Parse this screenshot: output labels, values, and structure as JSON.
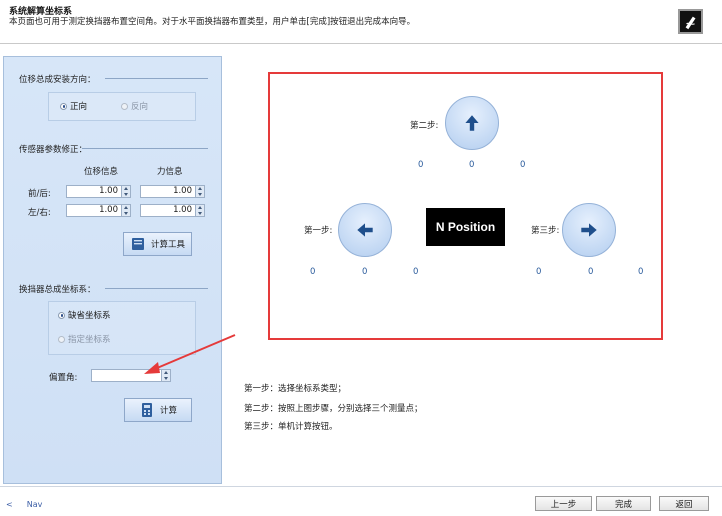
{
  "header": {
    "title": "系统解算坐标系",
    "description": "本页面也可用于测定换挡器布置空间角。对于水平面换挡器布置类型，用户单击[完成]按钮退出完成本向导。"
  },
  "sidebar": {
    "direction": {
      "label": "位移总成安装方向：",
      "options": [
        {
          "label": "正向",
          "selected": true
        },
        {
          "label": "反向",
          "selected": false
        }
      ]
    },
    "sensor": {
      "label": "传感器参数修正：",
      "col_disp": "位移信息",
      "col_force": "力信息",
      "rows": [
        {
          "label": "前/后:",
          "disp": "1.00",
          "force": "1.00"
        },
        {
          "label": "左/右:",
          "disp": "1.00",
          "force": "1.00"
        }
      ],
      "calc_tool_label": "计算工具"
    },
    "coord": {
      "label": "换挡器总成坐标系：",
      "options": [
        {
          "label": "缺省坐标系",
          "selected": true
        },
        {
          "label": "指定坐标系",
          "selected": false
        }
      ],
      "offset_label": "偏置角:",
      "offset_value": "",
      "calc_label": "计算"
    }
  },
  "canvas": {
    "center_label": "N Position",
    "step2": {
      "label": "第二步:",
      "values": [
        "0",
        "0",
        "0"
      ]
    },
    "step1": {
      "label": "第一步:",
      "values": [
        "0",
        "0",
        "0"
      ]
    },
    "step3": {
      "label": "第三步:",
      "values": [
        "0",
        "0",
        "0"
      ]
    }
  },
  "instructions": [
    "第一步：选择坐标系类型；",
    "第二步：按照上图步骤，分别选择三个测量点；",
    "第三步：单机计算按钮。"
  ],
  "footer": {
    "prev_symbol": "<",
    "nav_label": "Nav",
    "prev_button": "上一步",
    "finish_button": "完成",
    "back_button": "返回"
  },
  "colors": {
    "highlight_border": "#e53a3a",
    "sidebar_bg": "#d7e6f8",
    "arrow_color": "#1f4f8c"
  }
}
